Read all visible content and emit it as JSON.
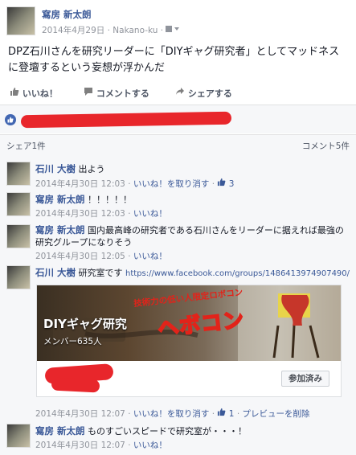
{
  "post": {
    "author": "寫房 新太朗",
    "date": "2014年4月29日",
    "location": "Nakano-ku",
    "text": "DPZ石川さんを研究リーダーに「DIYギャグ研究者」としてマッドネスに登壇するという妄想が浮かんだ"
  },
  "actions": {
    "like": "いいね！",
    "comment": "コメントする",
    "share": "シェアする"
  },
  "stats": {
    "shares": "シェア1件",
    "comments": "コメント5件"
  },
  "comments": [
    {
      "author": "石川 大樹",
      "text": "出よう",
      "time": "2014年4月30日 12:03",
      "like_action": "いいね！を取り消す",
      "likes": "3"
    },
    {
      "author": "寫房 新太朗",
      "text": "！！！！！",
      "time": "2014年4月30日 12:03",
      "like_action": "いいね！"
    },
    {
      "author": "寫房 新太朗",
      "text": "国内最高峰の研究者である石川さんをリーダーに据えれば最強の研究グループになりそう",
      "time": "2014年4月30日 12:05",
      "like_action": "いいね！"
    },
    {
      "author": "石川 大樹",
      "text": "研究室です",
      "url": "https://www.facebook.com/groups/1486413974907490/",
      "time": "2014年4月30日 12:07",
      "like_action": "いいね！を取り消す",
      "likes": "1",
      "extra_action": "プレビューを削除"
    },
    {
      "author": "寫房 新太朗",
      "text": "ものすごいスピードで研究室が・・・！",
      "time": "2014年4月30日 12:07",
      "like_action": "いいね！"
    }
  ],
  "preview": {
    "title": "DIYギャグ研究",
    "banner_main": "ヘボコン",
    "banner_sub": "技術力の低い人限定ロボコン",
    "members": "メンバー635人",
    "joined": "参加済み"
  },
  "separator": "·",
  "colors": {
    "link": "#3b5998",
    "redact": "#e8262b",
    "bg": "#f6f7f9"
  }
}
